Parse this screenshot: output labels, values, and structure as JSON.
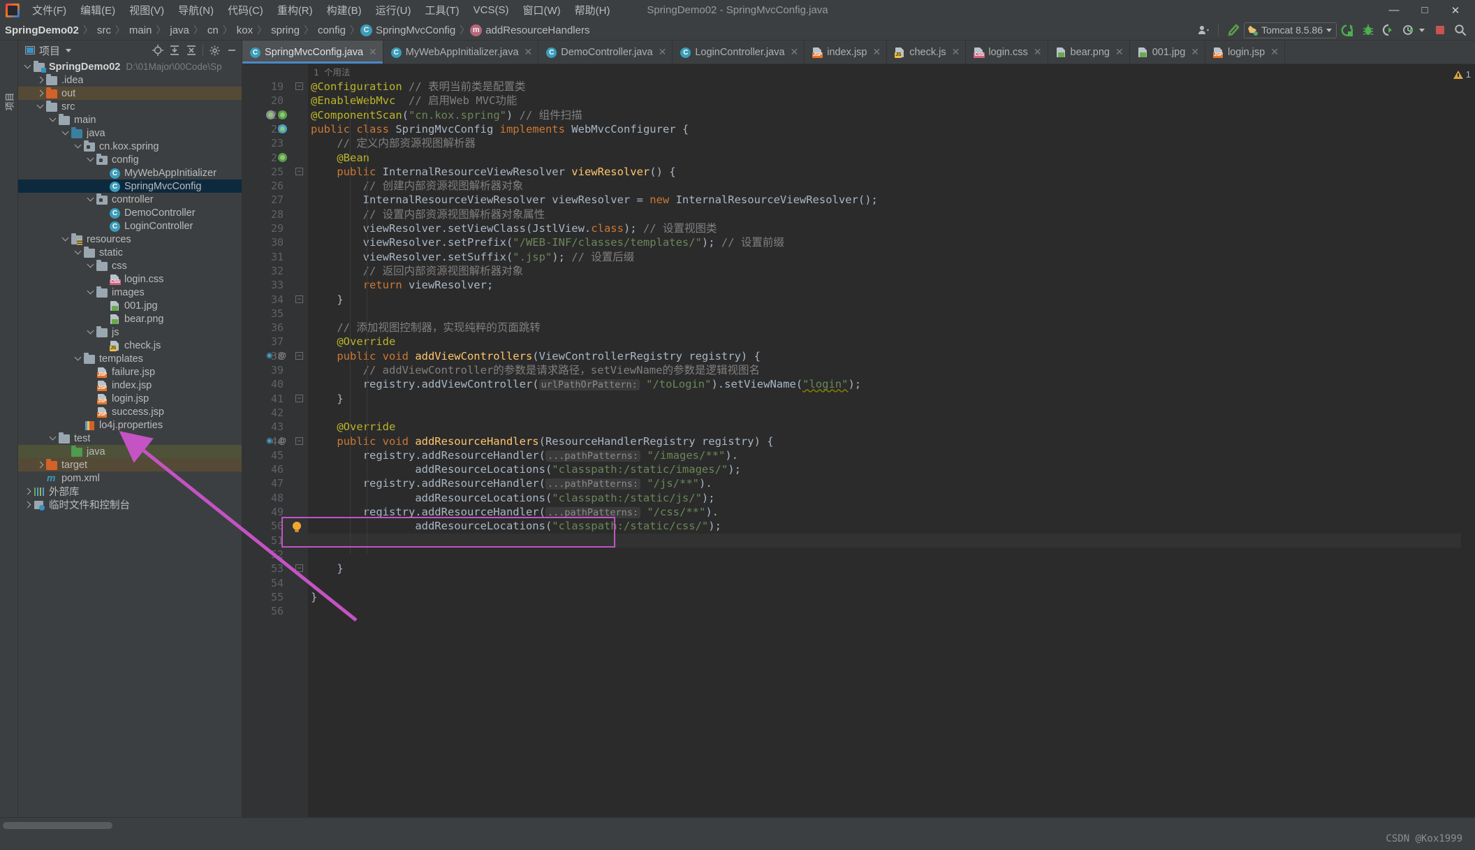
{
  "window": {
    "title": "SpringDemo02 - SpringMvcConfig.java",
    "minimize": "—",
    "maximize": "□",
    "close": "✕"
  },
  "menubar": {
    "items": [
      {
        "label": "文件(F)",
        "name": "menu-file"
      },
      {
        "label": "编辑(E)",
        "name": "menu-edit"
      },
      {
        "label": "视图(V)",
        "name": "menu-view"
      },
      {
        "label": "导航(N)",
        "name": "menu-navigate"
      },
      {
        "label": "代码(C)",
        "name": "menu-code"
      },
      {
        "label": "重构(R)",
        "name": "menu-refactor"
      },
      {
        "label": "构建(B)",
        "name": "menu-build"
      },
      {
        "label": "运行(U)",
        "name": "menu-run"
      },
      {
        "label": "工具(T)",
        "name": "menu-tools"
      },
      {
        "label": "VCS(S)",
        "name": "menu-vcs"
      },
      {
        "label": "窗口(W)",
        "name": "menu-window"
      },
      {
        "label": "帮助(H)",
        "name": "menu-help"
      }
    ]
  },
  "breadcrumbs": [
    {
      "label": "SpringDemo02",
      "bold": true
    },
    {
      "label": "src",
      "bold": false
    },
    {
      "label": "main",
      "bold": false
    },
    {
      "label": "java",
      "bold": false
    },
    {
      "label": "cn",
      "bold": false
    },
    {
      "label": "kox",
      "bold": false
    },
    {
      "label": "spring",
      "bold": false
    },
    {
      "label": "config",
      "bold": false
    },
    {
      "label": "SpringMvcConfig",
      "bold": false,
      "badge": "C"
    },
    {
      "label": "addResourceHandlers",
      "bold": false,
      "badge": "m"
    }
  ],
  "toolbar_right": {
    "run_config": "Tomcat 8.5.86",
    "icons": [
      "user-icon",
      "hammer-icon",
      "run-icon",
      "debug-icon",
      "coverage-icon",
      "profiler-icon",
      "stop-icon",
      "search-icon"
    ]
  },
  "project_panel": {
    "title": "项目",
    "header_icons": [
      "locate-icon",
      "expand-all-icon",
      "collapse-all-icon",
      "gear-icon",
      "hide-icon"
    ],
    "tree": [
      {
        "depth": 0,
        "arrow": "down",
        "icon": "project-folder",
        "label": "SpringDemo02",
        "bold": true,
        "sub": "D:\\01Major\\00Code\\Sp",
        "state": "none"
      },
      {
        "depth": 1,
        "arrow": "right",
        "icon": "folder-gray",
        "label": ".idea",
        "state": "none"
      },
      {
        "depth": 1,
        "arrow": "right",
        "icon": "folder-orange",
        "label": "out",
        "state": "brown"
      },
      {
        "depth": 1,
        "arrow": "down",
        "icon": "folder-gray",
        "label": "src",
        "state": "none"
      },
      {
        "depth": 2,
        "arrow": "down",
        "icon": "folder-gray",
        "label": "main",
        "state": "none"
      },
      {
        "depth": 3,
        "arrow": "down",
        "icon": "folder-blue",
        "label": "java",
        "state": "none"
      },
      {
        "depth": 4,
        "arrow": "down",
        "icon": "package",
        "label": "cn.kox.spring",
        "state": "none"
      },
      {
        "depth": 5,
        "arrow": "down",
        "icon": "package",
        "label": "config",
        "state": "none"
      },
      {
        "depth": 6,
        "arrow": "none",
        "icon": "class",
        "label": "MyWebAppInitializer",
        "state": "none"
      },
      {
        "depth": 6,
        "arrow": "none",
        "icon": "class",
        "label": "SpringMvcConfig",
        "state": "blue"
      },
      {
        "depth": 5,
        "arrow": "down",
        "icon": "package",
        "label": "controller",
        "state": "none"
      },
      {
        "depth": 6,
        "arrow": "none",
        "icon": "class",
        "label": "DemoController",
        "state": "none"
      },
      {
        "depth": 6,
        "arrow": "none",
        "icon": "class",
        "label": "LoginController",
        "state": "none"
      },
      {
        "depth": 3,
        "arrow": "down",
        "icon": "folder-resources",
        "label": "resources",
        "state": "none"
      },
      {
        "depth": 4,
        "arrow": "down",
        "icon": "folder-gray",
        "label": "static",
        "state": "none"
      },
      {
        "depth": 5,
        "arrow": "down",
        "icon": "folder-gray",
        "label": "css",
        "state": "none"
      },
      {
        "depth": 6,
        "arrow": "none",
        "icon": "file-css",
        "label": "login.css",
        "state": "none"
      },
      {
        "depth": 5,
        "arrow": "down",
        "icon": "folder-gray",
        "label": "images",
        "state": "none"
      },
      {
        "depth": 6,
        "arrow": "none",
        "icon": "file-image",
        "label": "001.jpg",
        "state": "none"
      },
      {
        "depth": 6,
        "arrow": "none",
        "icon": "file-image",
        "label": "bear.png",
        "state": "none"
      },
      {
        "depth": 5,
        "arrow": "down",
        "icon": "folder-gray",
        "label": "js",
        "state": "none"
      },
      {
        "depth": 6,
        "arrow": "none",
        "icon": "file-js",
        "label": "check.js",
        "state": "none"
      },
      {
        "depth": 4,
        "arrow": "down",
        "icon": "folder-gray",
        "label": "templates",
        "state": "none"
      },
      {
        "depth": 5,
        "arrow": "none",
        "icon": "file-jsp",
        "label": "failure.jsp",
        "state": "none"
      },
      {
        "depth": 5,
        "arrow": "none",
        "icon": "file-jsp",
        "label": "index.jsp",
        "state": "none"
      },
      {
        "depth": 5,
        "arrow": "none",
        "icon": "file-jsp",
        "label": "login.jsp",
        "state": "none"
      },
      {
        "depth": 5,
        "arrow": "none",
        "icon": "file-jsp",
        "label": "success.jsp",
        "state": "none"
      },
      {
        "depth": 4,
        "arrow": "none",
        "icon": "file-properties",
        "label": "lo4j.properties",
        "state": "none"
      },
      {
        "depth": 2,
        "arrow": "down",
        "icon": "folder-gray",
        "label": "test",
        "state": "none"
      },
      {
        "depth": 3,
        "arrow": "none",
        "icon": "folder-green",
        "label": "java",
        "state": "olive"
      },
      {
        "depth": 1,
        "arrow": "right",
        "icon": "folder-orange",
        "label": "target",
        "state": "brown"
      },
      {
        "depth": 1,
        "arrow": "none",
        "icon": "maven",
        "label": "pom.xml",
        "state": "none"
      },
      {
        "depth": 0,
        "arrow": "right",
        "icon": "library",
        "label": "外部库",
        "state": "none"
      },
      {
        "depth": 0,
        "arrow": "right",
        "icon": "scratches",
        "label": "临时文件和控制台",
        "state": "none"
      }
    ]
  },
  "left_rail": {
    "label": "项目"
  },
  "editor_tabs": [
    {
      "label": "SpringMvcConfig.java",
      "icon": "class-icon",
      "active": true
    },
    {
      "label": "MyWebAppInitializer.java",
      "icon": "class-icon",
      "active": false
    },
    {
      "label": "DemoController.java",
      "icon": "class-icon",
      "active": false
    },
    {
      "label": "LoginController.java",
      "icon": "class-icon",
      "active": false
    },
    {
      "label": "index.jsp",
      "icon": "jsp-icon",
      "active": false
    },
    {
      "label": "check.js",
      "icon": "js-icon",
      "active": false
    },
    {
      "label": "login.css",
      "icon": "css-icon",
      "active": false
    },
    {
      "label": "bear.png",
      "icon": "image-icon",
      "active": false
    },
    {
      "label": "001.jpg",
      "icon": "image-icon",
      "active": false
    },
    {
      "label": "login.jsp",
      "icon": "jsp-icon",
      "active": false
    }
  ],
  "editor": {
    "usage_note": "1 个用法",
    "first_line_number": 19,
    "last_line_number": 56,
    "warning_count": "1",
    "lines": [
      {
        "n": 19,
        "marks": [
          "fold-open"
        ],
        "segs": [
          {
            "t": "@Configuration",
            "c": "ann"
          },
          {
            "t": " ",
            "c": "txt"
          },
          {
            "t": "// 表明当前类是配置类",
            "c": "cmt"
          }
        ]
      },
      {
        "n": 20,
        "marks": [],
        "segs": [
          {
            "t": "@EnableWebMvc",
            "c": "ann"
          },
          {
            "t": "  ",
            "c": "txt"
          },
          {
            "t": "// 启用Web MVC功能",
            "c": "cmt"
          }
        ]
      },
      {
        "n": 21,
        "marks": [
          "usage",
          "bean"
        ],
        "segs": [
          {
            "t": "@ComponentScan",
            "c": "ann"
          },
          {
            "t": "(",
            "c": "txt"
          },
          {
            "t": "\"cn.kox.spring\"",
            "c": "str"
          },
          {
            "t": ") ",
            "c": "txt"
          },
          {
            "t": "// 组件扫描",
            "c": "cmt"
          }
        ]
      },
      {
        "n": 22,
        "marks": [
          "spring"
        ],
        "segs": [
          {
            "t": "public class ",
            "c": "kw"
          },
          {
            "t": "SpringMvcConfig ",
            "c": "txt"
          },
          {
            "t": "implements ",
            "c": "kw"
          },
          {
            "t": "WebMvcConfigurer {",
            "c": "txt"
          }
        ]
      },
      {
        "n": 23,
        "marks": [],
        "indent": 4,
        "segs": [
          {
            "t": "// 定义内部资源视图解析器",
            "c": "cmt"
          }
        ]
      },
      {
        "n": 24,
        "marks": [
          "bean"
        ],
        "indent": 4,
        "segs": [
          {
            "t": "@Bean",
            "c": "ann"
          }
        ]
      },
      {
        "n": 25,
        "marks": [
          "fold-open"
        ],
        "indent": 4,
        "segs": [
          {
            "t": "public ",
            "c": "kw"
          },
          {
            "t": "InternalResourceViewResolver ",
            "c": "txt"
          },
          {
            "t": "viewResolver",
            "c": "fn"
          },
          {
            "t": "() {",
            "c": "txt"
          }
        ]
      },
      {
        "n": 26,
        "marks": [],
        "indent": 8,
        "segs": [
          {
            "t": "// 创建内部资源视图解析器对象",
            "c": "cmt"
          }
        ]
      },
      {
        "n": 27,
        "marks": [],
        "indent": 8,
        "segs": [
          {
            "t": "InternalResourceViewResolver viewResolver = ",
            "c": "txt"
          },
          {
            "t": "new ",
            "c": "kw"
          },
          {
            "t": "InternalResourceViewResolver();",
            "c": "txt"
          }
        ]
      },
      {
        "n": 28,
        "marks": [],
        "indent": 8,
        "segs": [
          {
            "t": "// 设置内部资源视图解析器对象属性",
            "c": "cmt"
          }
        ]
      },
      {
        "n": 29,
        "marks": [],
        "indent": 8,
        "segs": [
          {
            "t": "viewResolver.setViewClass(JstlView.",
            "c": "txt"
          },
          {
            "t": "class",
            "c": "kw"
          },
          {
            "t": "); ",
            "c": "txt"
          },
          {
            "t": "// 设置视图类",
            "c": "cmt"
          }
        ]
      },
      {
        "n": 30,
        "marks": [],
        "indent": 8,
        "segs": [
          {
            "t": "viewResolver.setPrefix(",
            "c": "txt"
          },
          {
            "t": "\"/WEB-INF/classes/templates/\"",
            "c": "str"
          },
          {
            "t": "); ",
            "c": "txt"
          },
          {
            "t": "// 设置前缀",
            "c": "cmt"
          }
        ]
      },
      {
        "n": 31,
        "marks": [],
        "indent": 8,
        "segs": [
          {
            "t": "viewResolver.setSuffix(",
            "c": "txt"
          },
          {
            "t": "\".jsp\"",
            "c": "str"
          },
          {
            "t": "); ",
            "c": "txt"
          },
          {
            "t": "// 设置后缀",
            "c": "cmt"
          }
        ]
      },
      {
        "n": 32,
        "marks": [],
        "indent": 8,
        "segs": [
          {
            "t": "// 返回内部资源视图解析器对象",
            "c": "cmt"
          }
        ]
      },
      {
        "n": 33,
        "marks": [],
        "indent": 8,
        "segs": [
          {
            "t": "return ",
            "c": "kw"
          },
          {
            "t": "viewResolver;",
            "c": "txt"
          }
        ]
      },
      {
        "n": 34,
        "marks": [
          "fold-close"
        ],
        "indent": 4,
        "segs": [
          {
            "t": "}",
            "c": "txt"
          }
        ]
      },
      {
        "n": 35,
        "marks": [],
        "segs": []
      },
      {
        "n": 36,
        "marks": [],
        "indent": 4,
        "segs": [
          {
            "t": "// 添加视图控制器，实现纯粹的页面跳转",
            "c": "cmt"
          }
        ]
      },
      {
        "n": 37,
        "marks": [],
        "indent": 4,
        "segs": [
          {
            "t": "@Override",
            "c": "ann"
          }
        ]
      },
      {
        "n": 38,
        "marks": [
          "override",
          "fold-open"
        ],
        "indent": 4,
        "segs": [
          {
            "t": "public void ",
            "c": "kw"
          },
          {
            "t": "addViewControllers",
            "c": "fn"
          },
          {
            "t": "(ViewControllerRegistry registry) {",
            "c": "txt"
          }
        ]
      },
      {
        "n": 39,
        "marks": [],
        "indent": 8,
        "segs": [
          {
            "t": "// addViewController的参数是请求路径，setViewName的参数是逻辑视图名",
            "c": "cmt"
          }
        ]
      },
      {
        "n": 40,
        "marks": [],
        "indent": 8,
        "segs": [
          {
            "t": "registry.addViewController(",
            "c": "txt"
          },
          {
            "t": "urlPathOrPattern:",
            "c": "hint"
          },
          {
            "t": " ",
            "c": "txt"
          },
          {
            "t": "\"/toLogin\"",
            "c": "str"
          },
          {
            "t": ").setViewName(",
            "c": "txt"
          },
          {
            "t": "\"login\"",
            "c": "str warn"
          },
          {
            "t": ");",
            "c": "txt"
          }
        ]
      },
      {
        "n": 41,
        "marks": [
          "fold-close"
        ],
        "indent": 4,
        "segs": [
          {
            "t": "}",
            "c": "txt"
          }
        ]
      },
      {
        "n": 42,
        "marks": [],
        "segs": []
      },
      {
        "n": 43,
        "marks": [],
        "indent": 4,
        "segs": [
          {
            "t": "@Override",
            "c": "ann"
          }
        ]
      },
      {
        "n": 44,
        "marks": [
          "override",
          "fold-open"
        ],
        "indent": 4,
        "segs": [
          {
            "t": "public void ",
            "c": "kw"
          },
          {
            "t": "addResourceHandlers",
            "c": "fn"
          },
          {
            "t": "(ResourceHandlerRegistry registry) {",
            "c": "txt"
          }
        ]
      },
      {
        "n": 45,
        "marks": [],
        "indent": 8,
        "segs": [
          {
            "t": "registry.addResourceHandler(",
            "c": "txt"
          },
          {
            "t": "...pathPatterns:",
            "c": "hint"
          },
          {
            "t": " ",
            "c": "txt"
          },
          {
            "t": "\"/images/**\"",
            "c": "str"
          },
          {
            "t": ").",
            "c": "txt"
          }
        ]
      },
      {
        "n": 46,
        "marks": [],
        "indent": 16,
        "segs": [
          {
            "t": "addResourceLocations(",
            "c": "txt"
          },
          {
            "t": "\"classpath:/static/images/\"",
            "c": "str"
          },
          {
            "t": ");",
            "c": "txt"
          }
        ]
      },
      {
        "n": 47,
        "marks": [],
        "indent": 8,
        "segs": [
          {
            "t": "registry.addResourceHandler(",
            "c": "txt"
          },
          {
            "t": "...pathPatterns:",
            "c": "hint"
          },
          {
            "t": " ",
            "c": "txt"
          },
          {
            "t": "\"/js/**\"",
            "c": "str"
          },
          {
            "t": ").",
            "c": "txt"
          }
        ]
      },
      {
        "n": 48,
        "marks": [],
        "indent": 16,
        "segs": [
          {
            "t": "addResourceLocations(",
            "c": "txt"
          },
          {
            "t": "\"classpath:/static/js/\"",
            "c": "str"
          },
          {
            "t": ");",
            "c": "txt"
          }
        ]
      },
      {
        "n": 49,
        "marks": [],
        "indent": 8,
        "segs": [
          {
            "t": "registry.addResourceHandler(",
            "c": "txt"
          },
          {
            "t": "...pathPatterns:",
            "c": "hint"
          },
          {
            "t": " ",
            "c": "txt"
          },
          {
            "t": "\"/css/**\"",
            "c": "str"
          },
          {
            "t": ").",
            "c": "txt"
          }
        ]
      },
      {
        "n": 50,
        "marks": [
          "bulb"
        ],
        "indent": 16,
        "segs": [
          {
            "t": "addResourceLocations(",
            "c": "txt"
          },
          {
            "t": "\"classpath:/static/css/\"",
            "c": "str"
          },
          {
            "t": ");",
            "c": "txt"
          }
        ]
      },
      {
        "n": 51,
        "marks": [],
        "segs": [],
        "hl": true
      },
      {
        "n": 52,
        "marks": [],
        "segs": []
      },
      {
        "n": 53,
        "marks": [
          "fold-close"
        ],
        "indent": 4,
        "segs": [
          {
            "t": "}",
            "c": "txt"
          }
        ]
      },
      {
        "n": 54,
        "marks": [],
        "segs": []
      },
      {
        "n": 55,
        "marks": [],
        "segs": [
          {
            "t": "}",
            "c": "txt"
          }
        ]
      },
      {
        "n": 56,
        "marks": [],
        "segs": []
      }
    ]
  },
  "annotation": {
    "rect_color": "#c453c4",
    "arrow_color": "#c453c4",
    "note": "highlight on lines 47-48 with arrow pointing to js folder"
  },
  "watermark": "CSDN @Kox1999",
  "colors": {
    "accent_blue": "#4a88c7",
    "panel_bg": "#3c3f41",
    "editor_bg": "#2b2b2b",
    "gutter_bg": "#313335",
    "selection_blue": "#0d293e",
    "annotation_magenta": "#c453c4"
  }
}
